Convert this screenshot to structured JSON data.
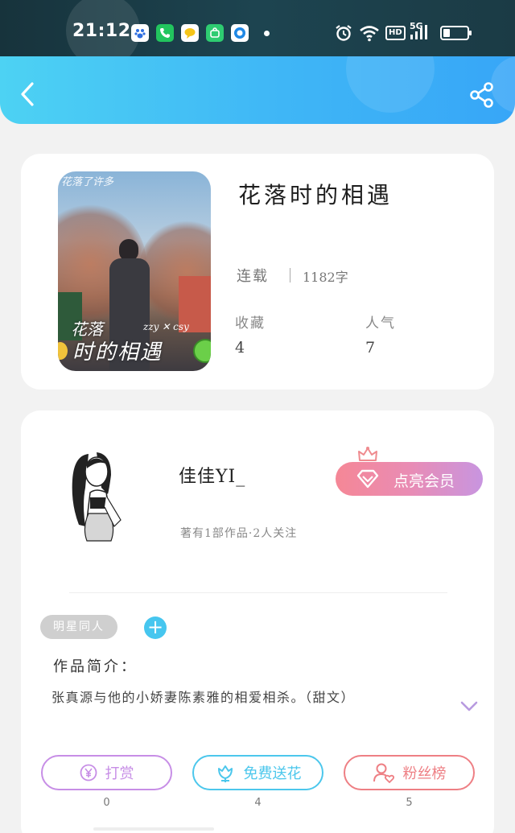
{
  "status_bar": {
    "time": "21:12",
    "apps": [
      "baidu-icon",
      "phone-icon",
      "chat-icon",
      "store-icon",
      "browser-icon"
    ],
    "icons": [
      "alarm-icon",
      "wifi-icon",
      "hd-icon",
      "signal-5g-icon",
      "battery-icon"
    ],
    "hd": "HD",
    "network": "5G"
  },
  "header": {
    "back_icon": "chevron-left-icon",
    "share_icon": "share-icon"
  },
  "book": {
    "title": "花落时的相遇",
    "status": "连载",
    "words": "1182字",
    "favorites_label": "收藏",
    "favorites": "4",
    "popularity_label": "人气",
    "popularity": "7",
    "cover_text": {
      "line1": "花落",
      "line2": "时的相遇",
      "credit": "zzy ✕ csy",
      "top": "花落了许多"
    }
  },
  "author": {
    "name": "佳佳YI_",
    "meta": "著有1部作品·2人关注",
    "vip_label": "点亮会员"
  },
  "tags": [
    "明星同人"
  ],
  "intro": {
    "title": "作品简介：",
    "text": "张真源与他的小娇妻陈素雅的相爱相杀。（甜文）"
  },
  "actions": [
    {
      "label": "打赏",
      "count": "0"
    },
    {
      "label": "免费送花",
      "count": "4"
    },
    {
      "label": "粉丝榜",
      "count": "5"
    }
  ],
  "colors": {
    "header_start": "#4dd2f3",
    "header_end": "#37a6f7",
    "reward": "#c78ee6",
    "flower": "#4cc7ec",
    "fans": "#ee7f84"
  }
}
